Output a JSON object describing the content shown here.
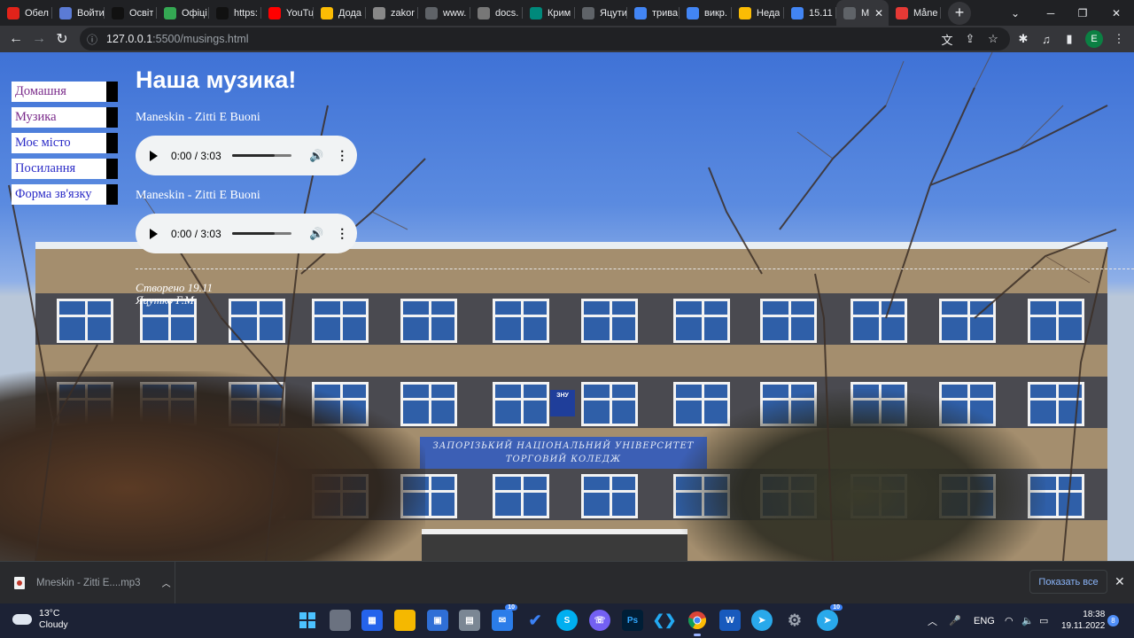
{
  "browser": {
    "tabs": [
      {
        "label": "Обел",
        "icon": "adobe-icon",
        "color": "#e2231a"
      },
      {
        "label": "Войти",
        "icon": "lightbulb-icon",
        "color": "#5b7bd5"
      },
      {
        "label": "Освіт",
        "icon": "dark-site-icon",
        "color": "#111111"
      },
      {
        "label": "Офіці",
        "icon": "green-circle-icon",
        "color": "#34a853"
      },
      {
        "label": "https:",
        "icon": "dark-site-icon",
        "color": "#111111"
      },
      {
        "label": "YouTu",
        "icon": "youtube-icon",
        "color": "#ff0000"
      },
      {
        "label": "Дода",
        "icon": "drive-icon",
        "color": "#fbbc04"
      },
      {
        "label": "zakor",
        "icon": "building-icon",
        "color": "#888888"
      },
      {
        "label": "www.",
        "icon": "globe-icon",
        "color": "#5f6368"
      },
      {
        "label": "docs.",
        "icon": "doc-icon",
        "color": "#777777"
      },
      {
        "label": "Крим",
        "icon": "site-icon",
        "color": "#00897b"
      },
      {
        "label": "Яцути",
        "icon": "globe-icon",
        "color": "#5f6368"
      },
      {
        "label": "трива",
        "icon": "google-icon",
        "color": "#4285f4"
      },
      {
        "label": "викр.",
        "icon": "google-icon",
        "color": "#4285f4"
      },
      {
        "label": "Неда",
        "icon": "drive-icon",
        "color": "#fbbc04"
      },
      {
        "label": "15.11",
        "icon": "photo-icon",
        "color": "#4285f4"
      },
      {
        "label": "M",
        "icon": "globe-icon",
        "color": "#5f6368",
        "active": true
      },
      {
        "label": "Måne",
        "icon": "music-icon",
        "color": "#e53935"
      }
    ],
    "url_host": "127.0.0.1",
    "url_path": ":5500/musings.html",
    "profile_initial": "E"
  },
  "site": {
    "nav": [
      "Домашня",
      "Музика",
      "Моє місто",
      "Посилання",
      "Форма зв'язку"
    ],
    "title": "Наша музика!",
    "tracks": [
      {
        "title": "Maneskin - Zitti E Buoni",
        "time": "0:00 / 3:03",
        "volume_fill": 0.72
      },
      {
        "title": "Maneskin - Zitti E Buoni",
        "time": "0:00 / 3:03",
        "volume_fill": 0.72
      }
    ],
    "footer_line1": "Створено 19.11",
    "footer_line2": "Яцутко Г.М.",
    "background_banner_line1": "ЗАПОРІЗЬКИЙ НАЦІОНАЛЬНИЙ УНІВЕРСИТЕТ",
    "background_banner_line2": "ТОРГОВИЙ КОЛЕДЖ",
    "background_logo": "ЗНУ"
  },
  "downloads": {
    "file": "Mneskin - Zitti E....mp3",
    "show_all": "Показать все"
  },
  "taskbar": {
    "temp": "13°C",
    "weather": "Cloudy",
    "lang": "ENG",
    "time": "18:38",
    "date": "19.11.2022",
    "notifications": "8",
    "badge_explorer": "10",
    "badge_telegram": "10"
  }
}
